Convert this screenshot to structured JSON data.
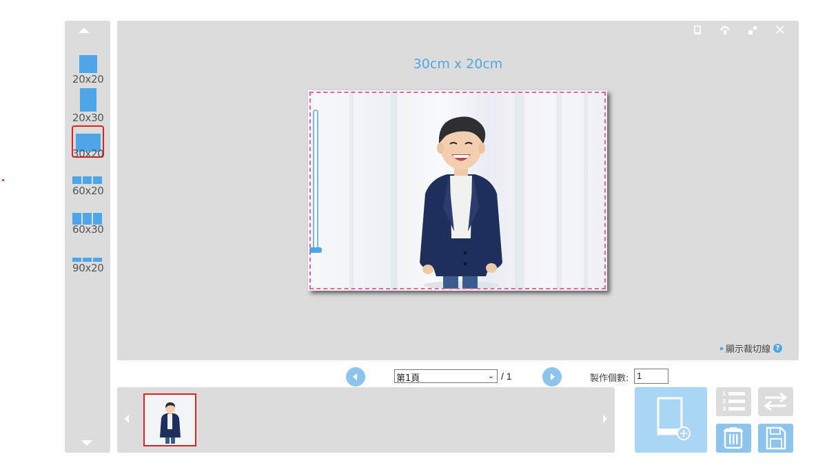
{
  "size_panel": {
    "options": [
      {
        "label": "20x20",
        "selected": false
      },
      {
        "label": "20x30",
        "selected": false
      },
      {
        "label": "30x20",
        "selected": true
      },
      {
        "label": "60x20",
        "selected": false
      },
      {
        "label": "60x30",
        "selected": false
      },
      {
        "label": "90x20",
        "selected": false
      }
    ]
  },
  "window_icons": [
    "portrait-icon",
    "rotate-icon",
    "expand-icon",
    "close-icon"
  ],
  "canvas": {
    "dimension_label": "30cm x 20cm",
    "show_cut_line_label": "顯示裁切線"
  },
  "pager": {
    "current_page": "第1頁",
    "total": "/ 1",
    "quantity_label": "製作個數:",
    "quantity_value": "1"
  },
  "colors": {
    "accent": "#4ea5e8",
    "panel_bg": "#dcdcdc",
    "selection": "#e02020",
    "cut_line": "#e8629a"
  }
}
